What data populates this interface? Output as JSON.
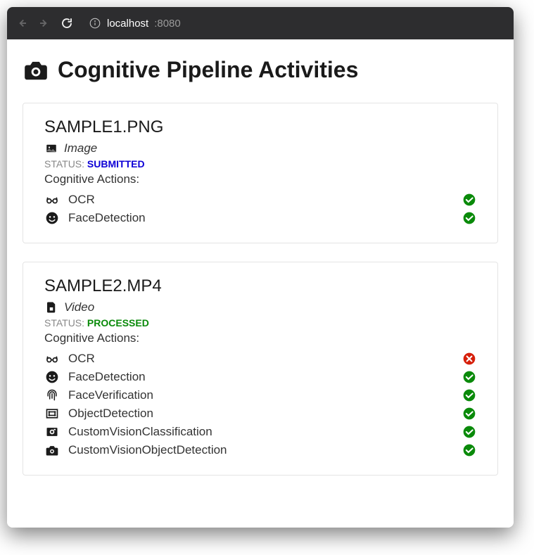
{
  "browser": {
    "url_host": "localhost",
    "url_port": ":8080"
  },
  "page": {
    "title": "Cognitive Pipeline Activities"
  },
  "cards": [
    {
      "title": "SAMPLE1.PNG",
      "media_icon": "image-icon",
      "media_type": "Image",
      "status_label": "STATUS:",
      "status_value": "SUBMITTED",
      "status_class": "status-submitted",
      "actions_label": "Cognitive Actions:",
      "actions": [
        {
          "icon": "glasses-icon",
          "label": "OCR",
          "status": "success"
        },
        {
          "icon": "face-icon",
          "label": "FaceDetection",
          "status": "success"
        }
      ]
    },
    {
      "title": "SAMPLE2.MP4",
      "media_icon": "video-file-icon",
      "media_type": "Video",
      "status_label": "STATUS:",
      "status_value": "PROCESSED",
      "status_class": "status-processed",
      "actions_label": "Cognitive Actions:",
      "actions": [
        {
          "icon": "glasses-icon",
          "label": "OCR",
          "status": "error"
        },
        {
          "icon": "face-icon",
          "label": "FaceDetection",
          "status": "success"
        },
        {
          "icon": "fingerprint-icon",
          "label": "FaceVerification",
          "status": "success"
        },
        {
          "icon": "object-icon",
          "label": "ObjectDetection",
          "status": "success"
        },
        {
          "icon": "camera-classify-icon",
          "label": "CustomVisionClassification",
          "status": "success"
        },
        {
          "icon": "camera-detect-icon",
          "label": "CustomVisionObjectDetection",
          "status": "success"
        }
      ]
    }
  ]
}
